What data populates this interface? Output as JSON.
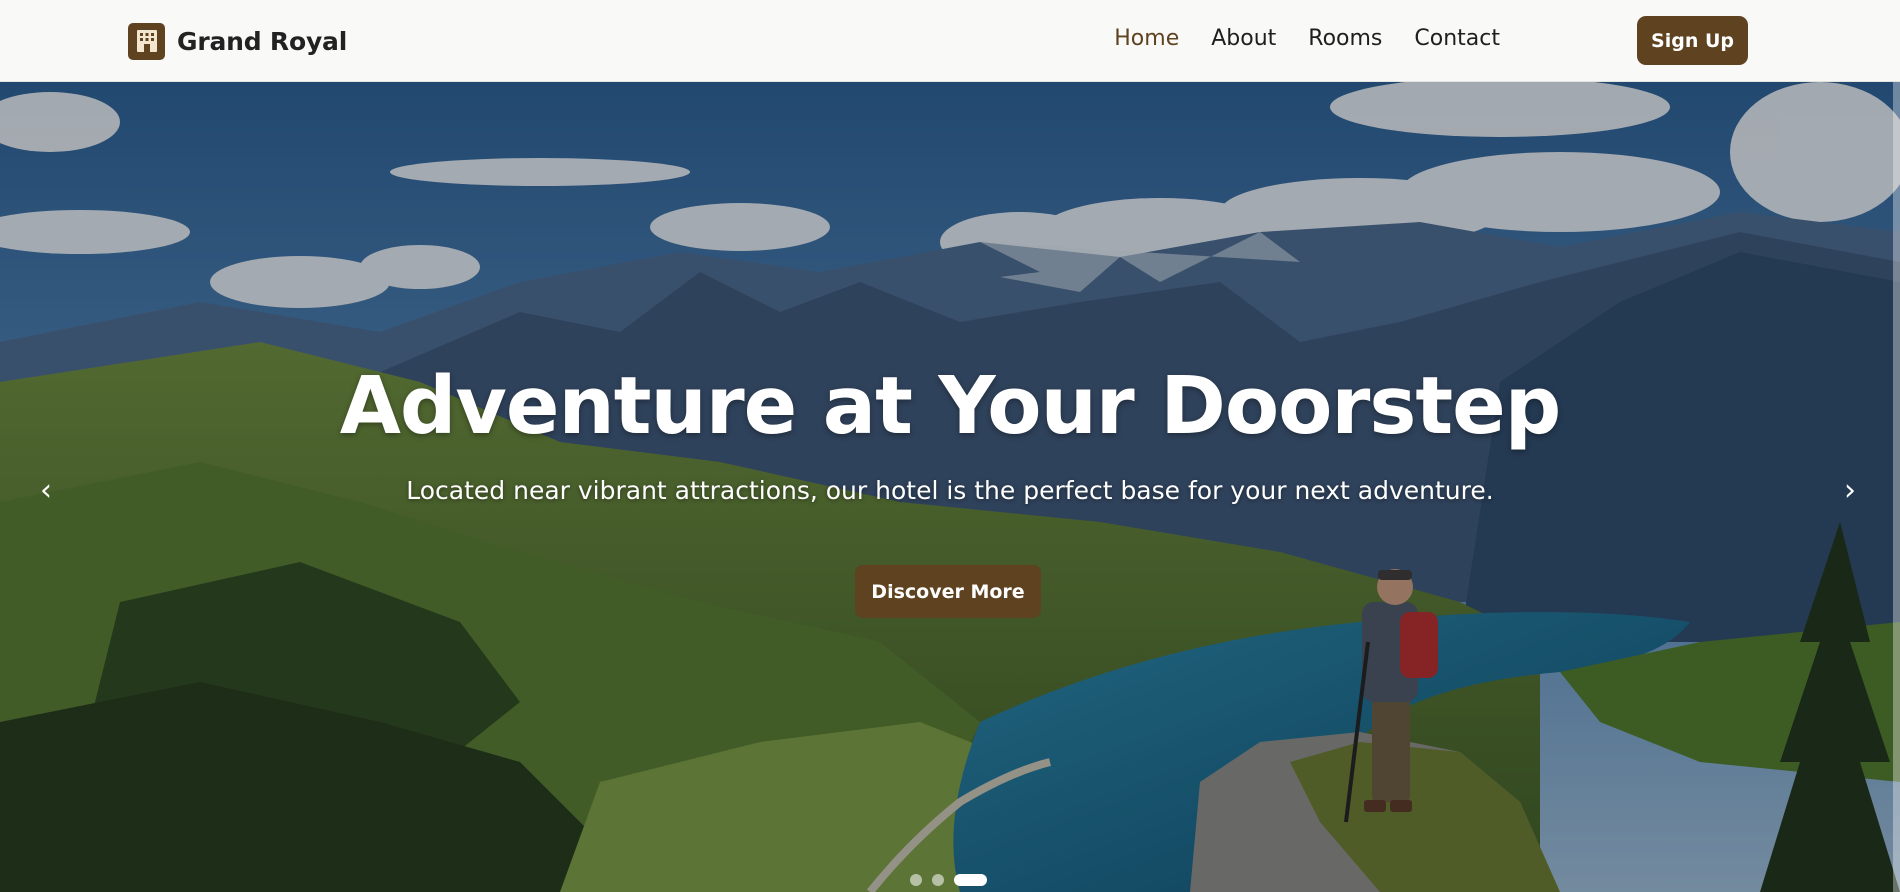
{
  "brand": {
    "name": "Grand Royal",
    "logo_icon": "hotel-building-icon"
  },
  "nav": {
    "links": [
      {
        "label": "Home",
        "active": true
      },
      {
        "label": "About",
        "active": false
      },
      {
        "label": "Rooms",
        "active": false
      },
      {
        "label": "Contact",
        "active": false
      }
    ],
    "signup_label": "Sign Up"
  },
  "hero": {
    "title": "Adventure at Your Doorstep",
    "subtitle": "Located near vibrant attractions, our hotel is the perfect base for your next adventure.",
    "cta_label": "Discover More",
    "prev_icon": "chevron-left-icon",
    "next_icon": "chevron-right-icon",
    "prev_glyph": "‹",
    "next_glyph": "›",
    "slides_total": 3,
    "active_slide": 3
  },
  "colors": {
    "brand_brown": "#5f4220",
    "nav_text": "#1f1f1f",
    "background": "#f9f9f8"
  }
}
